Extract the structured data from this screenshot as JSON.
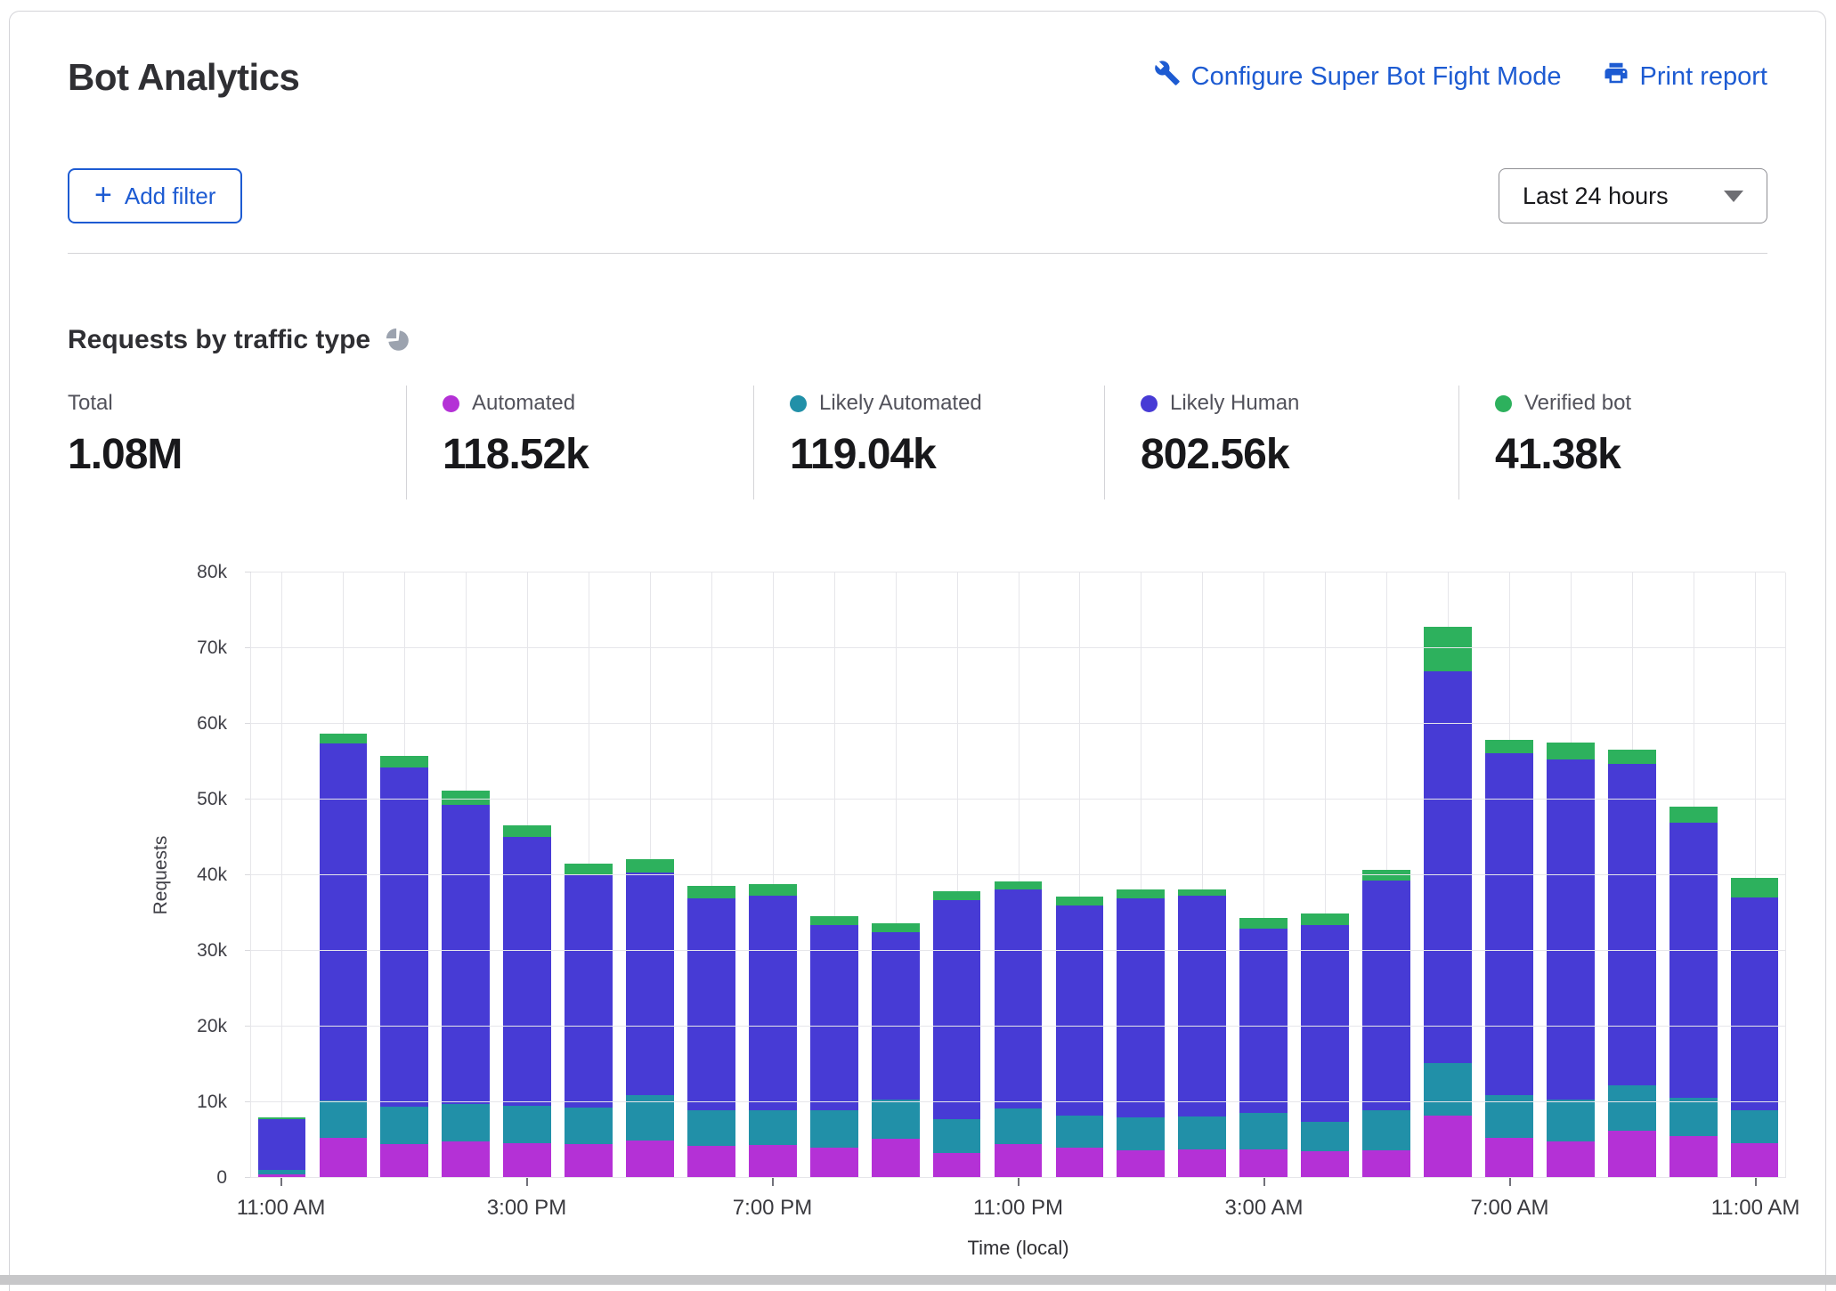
{
  "header": {
    "title": "Bot Analytics",
    "configure_link": "Configure Super Bot Fight Mode",
    "print_link": "Print report",
    "add_filter_plus": "+",
    "add_filter_label": "Add filter",
    "time_range": "Last 24 hours"
  },
  "section": {
    "title": "Requests by traffic type"
  },
  "stats": [
    {
      "label": "Total",
      "value": "1.08M",
      "color": null
    },
    {
      "label": "Automated",
      "value": "118.52k",
      "color": "#b431d6"
    },
    {
      "label": "Likely Automated",
      "value": "119.04k",
      "color": "#2190a8"
    },
    {
      "label": "Likely Human",
      "value": "802.56k",
      "color": "#473bd5"
    },
    {
      "label": "Verified bot",
      "value": "41.38k",
      "color": "#2db15d"
    }
  ],
  "chart_data": {
    "type": "bar",
    "stacked": true,
    "title": "Requests by traffic type",
    "xlabel": "Time (local)",
    "ylabel": "Requests",
    "ylim": [
      0,
      80000
    ],
    "grid": true,
    "yticks": [
      0,
      10000,
      20000,
      30000,
      40000,
      50000,
      60000,
      70000,
      80000
    ],
    "ytick_labels": [
      "0",
      "10k",
      "20k",
      "30k",
      "40k",
      "50k",
      "60k",
      "70k",
      "80k"
    ],
    "xticks": [
      0,
      4,
      8,
      12,
      16,
      20,
      24
    ],
    "xtick_labels": [
      "11:00 AM",
      "3:00 PM",
      "7:00 PM",
      "11:00 PM",
      "3:00 AM",
      "7:00 AM",
      "11:00 AM"
    ],
    "categories": [
      "11:00 AM",
      "12:00 PM",
      "1:00 PM",
      "2:00 PM",
      "3:00 PM",
      "4:00 PM",
      "5:00 PM",
      "6:00 PM",
      "7:00 PM",
      "8:00 PM",
      "9:00 PM",
      "10:00 PM",
      "11:00 PM",
      "12:00 AM",
      "1:00 AM",
      "2:00 AM",
      "3:00 AM",
      "4:00 AM",
      "5:00 AM",
      "6:00 AM",
      "7:00 AM",
      "8:00 AM",
      "9:00 AM",
      "10:00 AM",
      "11:00 AM"
    ],
    "series": [
      {
        "name": "Automated",
        "color": "#b431d6",
        "values": [
          450,
          5300,
          4500,
          4800,
          4600,
          4500,
          4900,
          4200,
          4300,
          4000,
          5200,
          3300,
          4500,
          4000,
          3600,
          3800,
          3800,
          3500,
          3600,
          8200,
          5300,
          4800,
          6200,
          5500,
          4600
        ]
      },
      {
        "name": "Likely Automated",
        "color": "#2190a8",
        "values": [
          600,
          4900,
          4900,
          5000,
          4900,
          4800,
          6000,
          4700,
          4600,
          4900,
          5100,
          4500,
          4700,
          4200,
          4400,
          4300,
          4800,
          3900,
          5400,
          7000,
          5600,
          5500,
          6000,
          5100,
          4300
        ]
      },
      {
        "name": "Likely Human",
        "color": "#473bd5",
        "values": [
          6750,
          47200,
          44800,
          39500,
          35600,
          30700,
          29500,
          28000,
          28400,
          24500,
          22200,
          28900,
          28900,
          27800,
          28900,
          29200,
          24300,
          26000,
          30300,
          51800,
          45200,
          45000,
          42500,
          36300,
          28200
        ]
      },
      {
        "name": "Verified bot",
        "color": "#2db15d",
        "values": [
          200,
          1300,
          1600,
          1900,
          1500,
          1500,
          1700,
          1700,
          1500,
          1200,
          1100,
          1200,
          1100,
          1200,
          1200,
          800,
          1500,
          1500,
          1400,
          5800,
          1800,
          2200,
          1900,
          2200,
          2500
        ]
      }
    ]
  }
}
